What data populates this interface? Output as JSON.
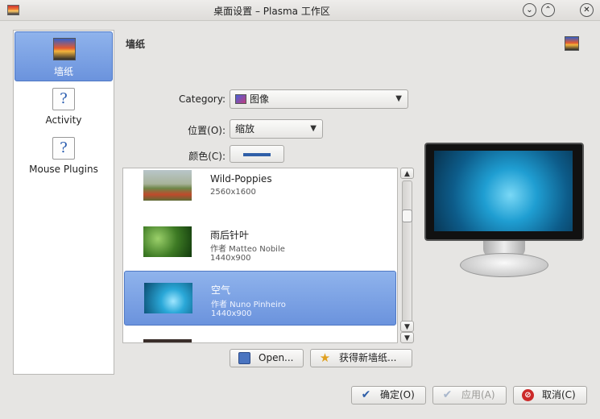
{
  "window": {
    "title": "桌面设置 – Plasma 工作区",
    "btn_minimize": "⌄",
    "btn_maximize": "⌃",
    "btn_close": "✕"
  },
  "sidebar": {
    "items": [
      {
        "label": "墙纸",
        "icon": "wallpaper-icon"
      },
      {
        "label": "Activity",
        "icon": "help-doc-icon"
      },
      {
        "label": "Mouse Plugins",
        "icon": "help-doc-icon"
      }
    ]
  },
  "page": {
    "title": "墙纸"
  },
  "form": {
    "category_label": "Category:",
    "category_value": "图像",
    "position_label": "位置(O):",
    "position_value": "缩放",
    "color_label": "颜色(C):",
    "color_value": "#2f5fa8"
  },
  "wallpapers": [
    {
      "name": "Wild-Poppies",
      "author": "",
      "size": "2560x1600"
    },
    {
      "name": "雨后针叶",
      "author": "作者 Matteo Nobile",
      "size": "1440x900"
    },
    {
      "name": "空气",
      "author": "作者 Nuno Pinheiro",
      "size": "1440x900"
    }
  ],
  "actions": {
    "open": "Open...",
    "get_new": "获得新墙纸..."
  },
  "dialog_buttons": {
    "ok": "确定(O)",
    "apply": "应用(A)",
    "cancel": "取消(C)"
  },
  "colors": {
    "selection": "#6b93dd",
    "accent": "#2f5fa8"
  }
}
